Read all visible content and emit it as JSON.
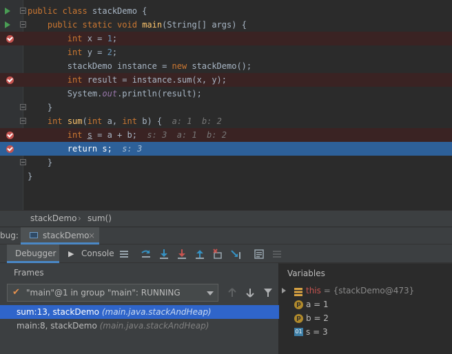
{
  "editor": {
    "lines": [
      {
        "indent": "",
        "tokens": [
          [
            "k",
            "public class "
          ],
          [
            "t",
            "stackDemo {"
          ]
        ]
      },
      {
        "indent": "    ",
        "tokens": [
          [
            "k",
            "public static void "
          ],
          [
            "f",
            "main"
          ],
          [
            "t",
            "(String[] args) {"
          ]
        ]
      },
      {
        "indent": "        ",
        "tokens": [
          [
            "k",
            "int "
          ],
          [
            "t",
            "x = "
          ],
          [
            "n",
            "1"
          ],
          [
            "t",
            ";"
          ]
        ]
      },
      {
        "indent": "        ",
        "tokens": [
          [
            "k",
            "int "
          ],
          [
            "t",
            "y = "
          ],
          [
            "n",
            "2"
          ],
          [
            "t",
            ";"
          ]
        ]
      },
      {
        "indent": "        ",
        "tokens": [
          [
            "t",
            "stackDemo instance = "
          ],
          [
            "k",
            "new "
          ],
          [
            "t",
            "stackDemo();"
          ]
        ]
      },
      {
        "indent": "        ",
        "tokens": [
          [
            "k",
            "int "
          ],
          [
            "t",
            "result = instance.sum(x, y);"
          ]
        ]
      },
      {
        "indent": "        ",
        "tokens": [
          [
            "t",
            "System."
          ],
          [
            "o",
            "out"
          ],
          [
            "t",
            ".println(result);"
          ]
        ]
      },
      {
        "indent": "    ",
        "tokens": [
          [
            "t",
            "}"
          ]
        ]
      },
      {
        "indent": "    ",
        "tokens": [
          [
            "k",
            "int "
          ],
          [
            "f",
            "sum"
          ],
          [
            "t",
            "("
          ],
          [
            "k",
            "int "
          ],
          [
            "t",
            "a, "
          ],
          [
            "k",
            "int "
          ],
          [
            "t",
            "b) {  "
          ],
          [
            "h",
            "a: 1  b: 2"
          ]
        ]
      },
      {
        "indent": "        ",
        "tokens": [
          [
            "k",
            "int "
          ],
          [
            "u",
            "s"
          ],
          [
            "t",
            " = a + b;  "
          ],
          [
            "h",
            "s: 3  a: 1  b: 2"
          ]
        ]
      },
      {
        "indent": "        ",
        "tokens": [
          [
            "k",
            "return "
          ],
          [
            "t",
            "s;  "
          ],
          [
            "h",
            "s: 3"
          ]
        ]
      },
      {
        "indent": "    ",
        "tokens": [
          [
            "t",
            "}"
          ]
        ]
      },
      {
        "indent": "",
        "tokens": [
          [
            "t",
            "}"
          ]
        ]
      }
    ]
  },
  "breadcrumb": {
    "class_name": "stackDemo",
    "separator": "›",
    "method": "sum()"
  },
  "debug": {
    "label": "bug:",
    "tab_label": "stackDemo",
    "close": "×"
  },
  "toolbar": {
    "debugger_label": "Debugger",
    "console_label": "Console"
  },
  "frames": {
    "title": "Frames",
    "thread": "\"main\"@1 in group \"main\": RUNNING",
    "items": [
      {
        "name": "sum:13, stackDemo ",
        "pkg": "(main.java.stackAndHeap)"
      },
      {
        "name": "main:8, stackDemo ",
        "pkg": "(main.java.stackAndHeap)"
      }
    ]
  },
  "variables": {
    "title": "Variables",
    "items": [
      {
        "name": "this",
        "value": " = {stackDemo@473}",
        "icon": "field-list-icon"
      },
      {
        "name": "a",
        "value": " = 1",
        "icon": "p-icon"
      },
      {
        "name": "b",
        "value": " = 2",
        "icon": "p-icon"
      },
      {
        "name": "s",
        "value": " = 3",
        "icon": "local-01-icon"
      }
    ]
  },
  "colors": {
    "background": "#2b2b2b",
    "current_line": "#2d6099",
    "breakpoint_line": "#3a2323",
    "keyword": "#cc7832",
    "accent": "#4a88c7"
  }
}
